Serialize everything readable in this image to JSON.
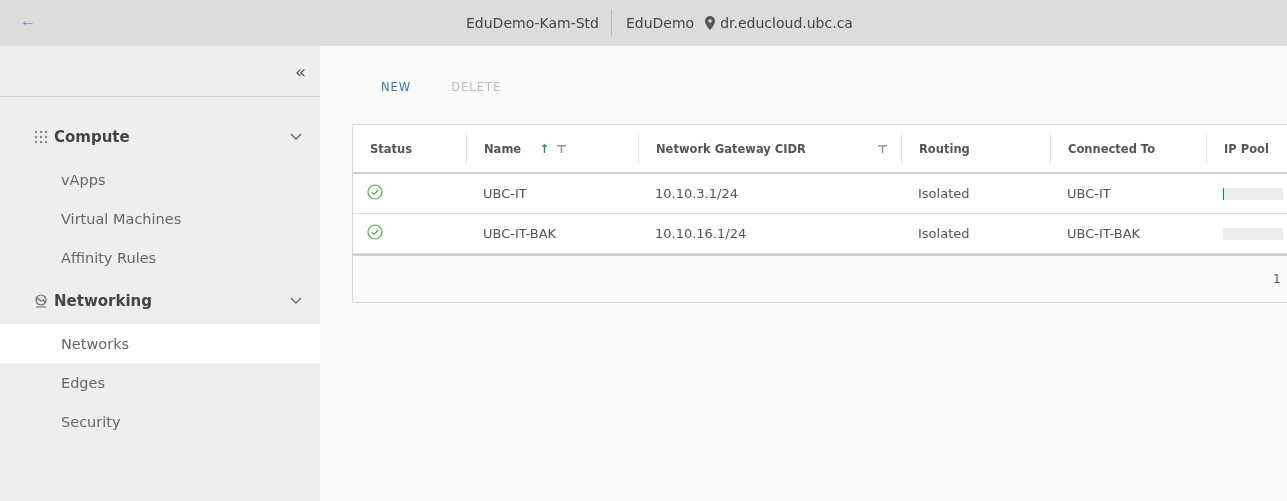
{
  "header": {
    "back": "←",
    "title": "EduDemo-Kam-Std",
    "org": "EduDemo",
    "site": "dr.educloud.ubc.ca"
  },
  "sidebar": {
    "collapse": "«",
    "groups": [
      {
        "label": "Compute",
        "expanded": true,
        "children": [
          {
            "label": "vApps",
            "selected": false
          },
          {
            "label": "Virtual Machines",
            "selected": false
          },
          {
            "label": "Affinity Rules",
            "selected": false
          }
        ]
      },
      {
        "label": "Networking",
        "expanded": true,
        "children": [
          {
            "label": "Networks",
            "selected": true
          },
          {
            "label": "Edges",
            "selected": false
          },
          {
            "label": "Security",
            "selected": false
          }
        ]
      }
    ]
  },
  "toolbar": [
    {
      "label": "NEW",
      "disabled": false
    },
    {
      "label": "DELETE",
      "disabled": true
    }
  ],
  "table": {
    "columns": [
      {
        "label": "Status",
        "filterable": false
      },
      {
        "label": "Name",
        "sort_arrow": "↑",
        "filterable": true
      },
      {
        "label": "Network Gateway CIDR",
        "filterable": true
      },
      {
        "label": "Routing",
        "filterable": false
      },
      {
        "label": "Connected To",
        "filterable": false
      },
      {
        "label": "IP Pool",
        "filterable": false
      }
    ],
    "rows": [
      {
        "ok": true,
        "name": "UBC-IT",
        "cidr": "10.10.3.1/24",
        "routing": "Isolated",
        "connected_to": "UBC-IT",
        "ip_pool": {
          "level": 0.02
        }
      },
      {
        "ok": true,
        "name": "UBC-IT-BAK",
        "cidr": "10.10.16.1/24",
        "routing": "Isolated",
        "connected_to": "UBC-IT-BAK"
      }
    ],
    "footer": "1"
  }
}
